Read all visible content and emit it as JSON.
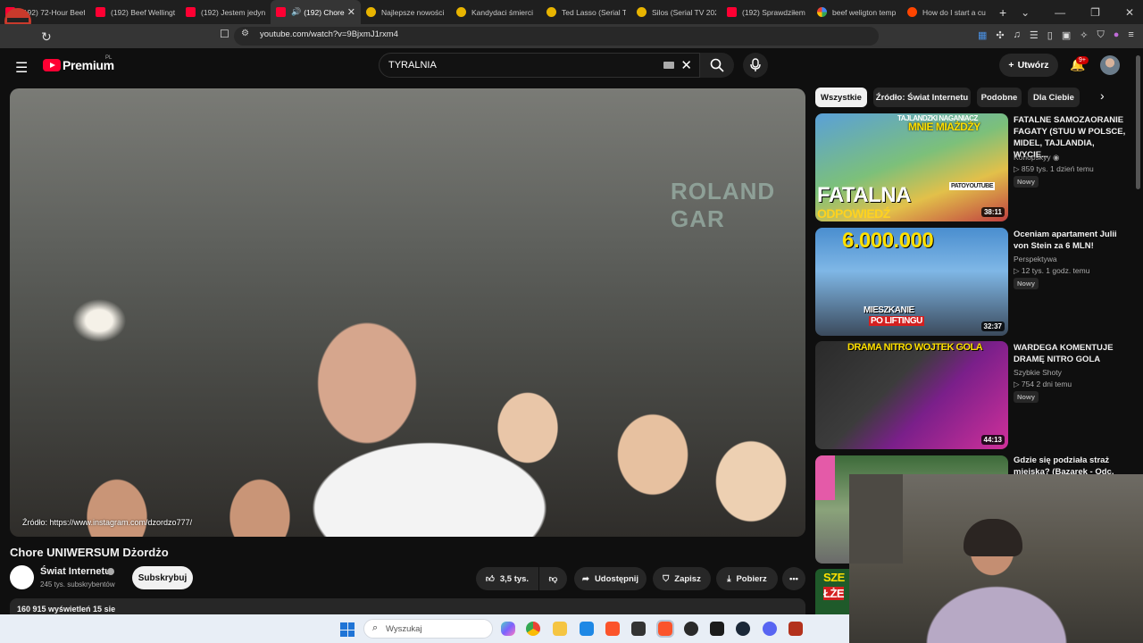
{
  "browser": {
    "tabs": [
      {
        "title": "(192) 72-Hour Beef",
        "icon": "youtube-icon",
        "active": false
      },
      {
        "title": "(192) Beef Wellingt",
        "icon": "youtube-icon",
        "active": false
      },
      {
        "title": "(192) Jestem jedyny",
        "icon": "youtube-icon",
        "active": false
      },
      {
        "title": "(192) Chore",
        "icon": "youtube-icon",
        "active": true
      },
      {
        "title": "Najlepsze nowości",
        "icon": "imdb-icon",
        "active": false
      },
      {
        "title": "Kandydaci śmierci",
        "icon": "imdb-icon",
        "active": false
      },
      {
        "title": "Ted Lasso (Serial TV",
        "icon": "imdb-icon",
        "active": false
      },
      {
        "title": "Silos (Serial TV 202",
        "icon": "imdb-icon",
        "active": false
      },
      {
        "title": "(192) Sprawdziłem",
        "icon": "youtube-icon",
        "active": false
      },
      {
        "title": "beef weligton temp",
        "icon": "google-icon",
        "active": false
      },
      {
        "title": "How do I start a cu",
        "icon": "reddit-icon",
        "active": false
      }
    ],
    "new_tab_symbol": "+",
    "url": "youtube.com/watch?v=9BjxmJ1rxm4"
  },
  "header": {
    "brand": "Premium",
    "brand_region": "PL",
    "search_value": "TYRALNIA",
    "create_label": "Utwórz",
    "notifications_badge": "9+"
  },
  "video": {
    "title": "Chore UNIWERSUM Dżordżo",
    "overlay_text": "Źródło: https://www.instagram.com/dzordzo777/",
    "background_sign": "ROLAND GAR",
    "channel_name": "Świat Internetu",
    "channel_subs": "245 tys. subskrybentów",
    "subscribe_label": "Subskrybuj",
    "like_count": "3,5 tys.",
    "share_label": "Udostępnij",
    "save_label": "Zapisz",
    "download_label": "Pobierz",
    "views_and_date": "160 915 wyświetleń  15 sie"
  },
  "chips": [
    "Wszystkie",
    "Źródło: Świat Internetu",
    "Podobne",
    "Dla Ciebie"
  ],
  "recommendations": [
    {
      "title": "FATALNE SAMOZAORANIE FAGATY (STUU W POLSCE, MIDEL, TAJLANDIA, WYCIE...",
      "channel": "Konopskyy",
      "meta": "859 tys.  1 dzień temu",
      "badge": "Nowy",
      "duration": "38:11",
      "thumb_top": "TAJLANDZKI NAGANIACZ",
      "thumb_top2": "MNIE MIAŻDŻY",
      "thumb_main": "FATALNA",
      "thumb_sub": "ODPOWIEDŹ",
      "thumb_tag": "PATOYOUTUBE"
    },
    {
      "title": "Oceniam apartament Julii von Stein za 6 MLN!",
      "channel": "Perspektywa",
      "meta": "12 tys.  1 godz. temu",
      "badge": "Nowy",
      "duration": "32:37",
      "thumb_main": "6.000.000",
      "thumb_sub": "MIESZKANIE",
      "thumb_sub2": "PO LIFTINGU"
    },
    {
      "title": "WARDEGA KOMENTUJE DRAMĘ NITRO GOLA",
      "channel": "Szybkie Shoty",
      "meta": "754  2 dni temu",
      "badge": "Nowy",
      "duration": "44:13",
      "thumb_main": "DRAMA NITRO WOJTEK GOLA"
    },
    {
      "title": "Gdzie się podziała straż miejska? (Bazarek - Odc. 10)"
    }
  ],
  "partial_thumb_text": [
    "SZE",
    "ŁŻE"
  ],
  "taskbar": {
    "search_placeholder": "Wyszukaj"
  }
}
